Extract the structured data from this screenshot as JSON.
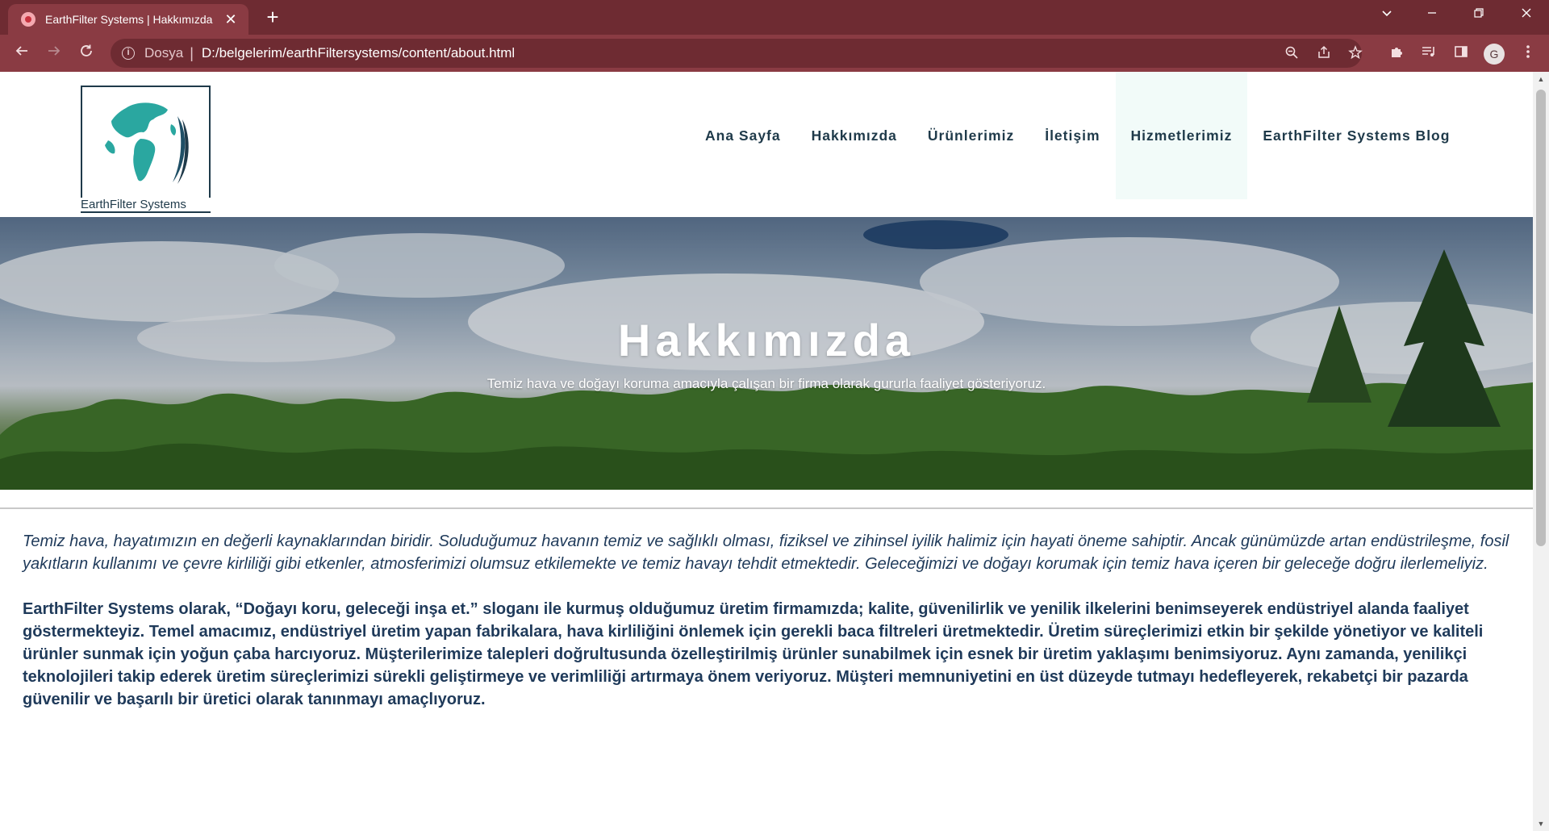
{
  "browser": {
    "tab_title": "EarthFilter Systems | Hakkımızda",
    "tab_close": "✕",
    "new_tab": "+",
    "scheme_label": "Dosya",
    "separator": "|",
    "url": "D:/belgelerim/earthFiltersystems/content/about.html",
    "profile_initial": "G",
    "accent_color": "#6e2b32",
    "toolbar_color": "#8a3b43",
    "icons": {
      "back": "back-arrow-icon",
      "forward": "forward-arrow-icon",
      "reload": "reload-icon",
      "zoom": "zoom-icon",
      "share": "share-icon",
      "bookmark": "star-icon",
      "extensions": "puzzle-icon",
      "media": "media-queue-icon",
      "side_panel": "side-panel-icon",
      "menu": "kebab-menu-icon"
    }
  },
  "site": {
    "logo_text": "EarthFilter Systems",
    "nav": [
      {
        "label": "Ana Sayfa"
      },
      {
        "label": "Hakkımızda"
      },
      {
        "label": "Ürünlerimiz"
      },
      {
        "label": "İletişim"
      },
      {
        "label": "Hizmetlerimiz"
      },
      {
        "label": "EarthFilter Systems Blog"
      }
    ],
    "text_color": "#1f3a4a"
  },
  "hero": {
    "title": "Hakkımızda",
    "subtitle": "Temiz hava ve doğayı koruma amacıyla çalışan bir firma olarak gururla faaliyet gösteriyoruz."
  },
  "content": {
    "paragraph_1": "Temiz hava, hayatımızın en değerli kaynaklarından biridir. Soluduğumuz havanın temiz ve sağlıklı olması, fiziksel ve zihinsel iyilik halimiz için hayati öneme sahiptir. Ancak günümüzde artan endüstrileşme, fosil yakıtların kullanımı ve çevre kirliliği gibi etkenler, atmosferimizi olumsuz etkilemekte ve temiz havayı tehdit etmektedir. Geleceğimizi ve doğayı korumak için temiz hava içeren bir geleceğe doğru ilerlemeliyiz.",
    "paragraph_2": "EarthFilter Systems olarak, “Doğayı koru, geleceği inşa et.” sloganı ile kurmuş olduğumuz üretim firmamızda; kalite, güvenilirlik ve yenilik ilkelerini benimseyerek endüstriyel alanda faaliyet göstermekteyiz. Temel amacımız, endüstriyel üretim yapan fabrikalara, hava kirliliğini önlemek için gerekli baca filtreleri üretmektedir. Üretim süreçlerimizi etkin bir şekilde yönetiyor ve kaliteli ürünler sunmak için yoğun çaba harcıyoruz. Müşterilerimize talepleri doğrultusunda özelleştirilmiş ürünler sunabilmek için esnek bir üretim yaklaşımı benimsiyoruz. Aynı zamanda, yenilikçi teknolojileri takip ederek üretim süreçlerimizi sürekli geliştirmeye ve verimliliği artırmaya önem veriyoruz. Müşteri memnuniyetini en üst düzeyde tutmayı hedefleyerek, rekabetçi bir pazarda güvenilir ve başarılı bir üretici olarak tanınmayı amaçlıyoruz.",
    "text_color": "#1f3a5a"
  }
}
